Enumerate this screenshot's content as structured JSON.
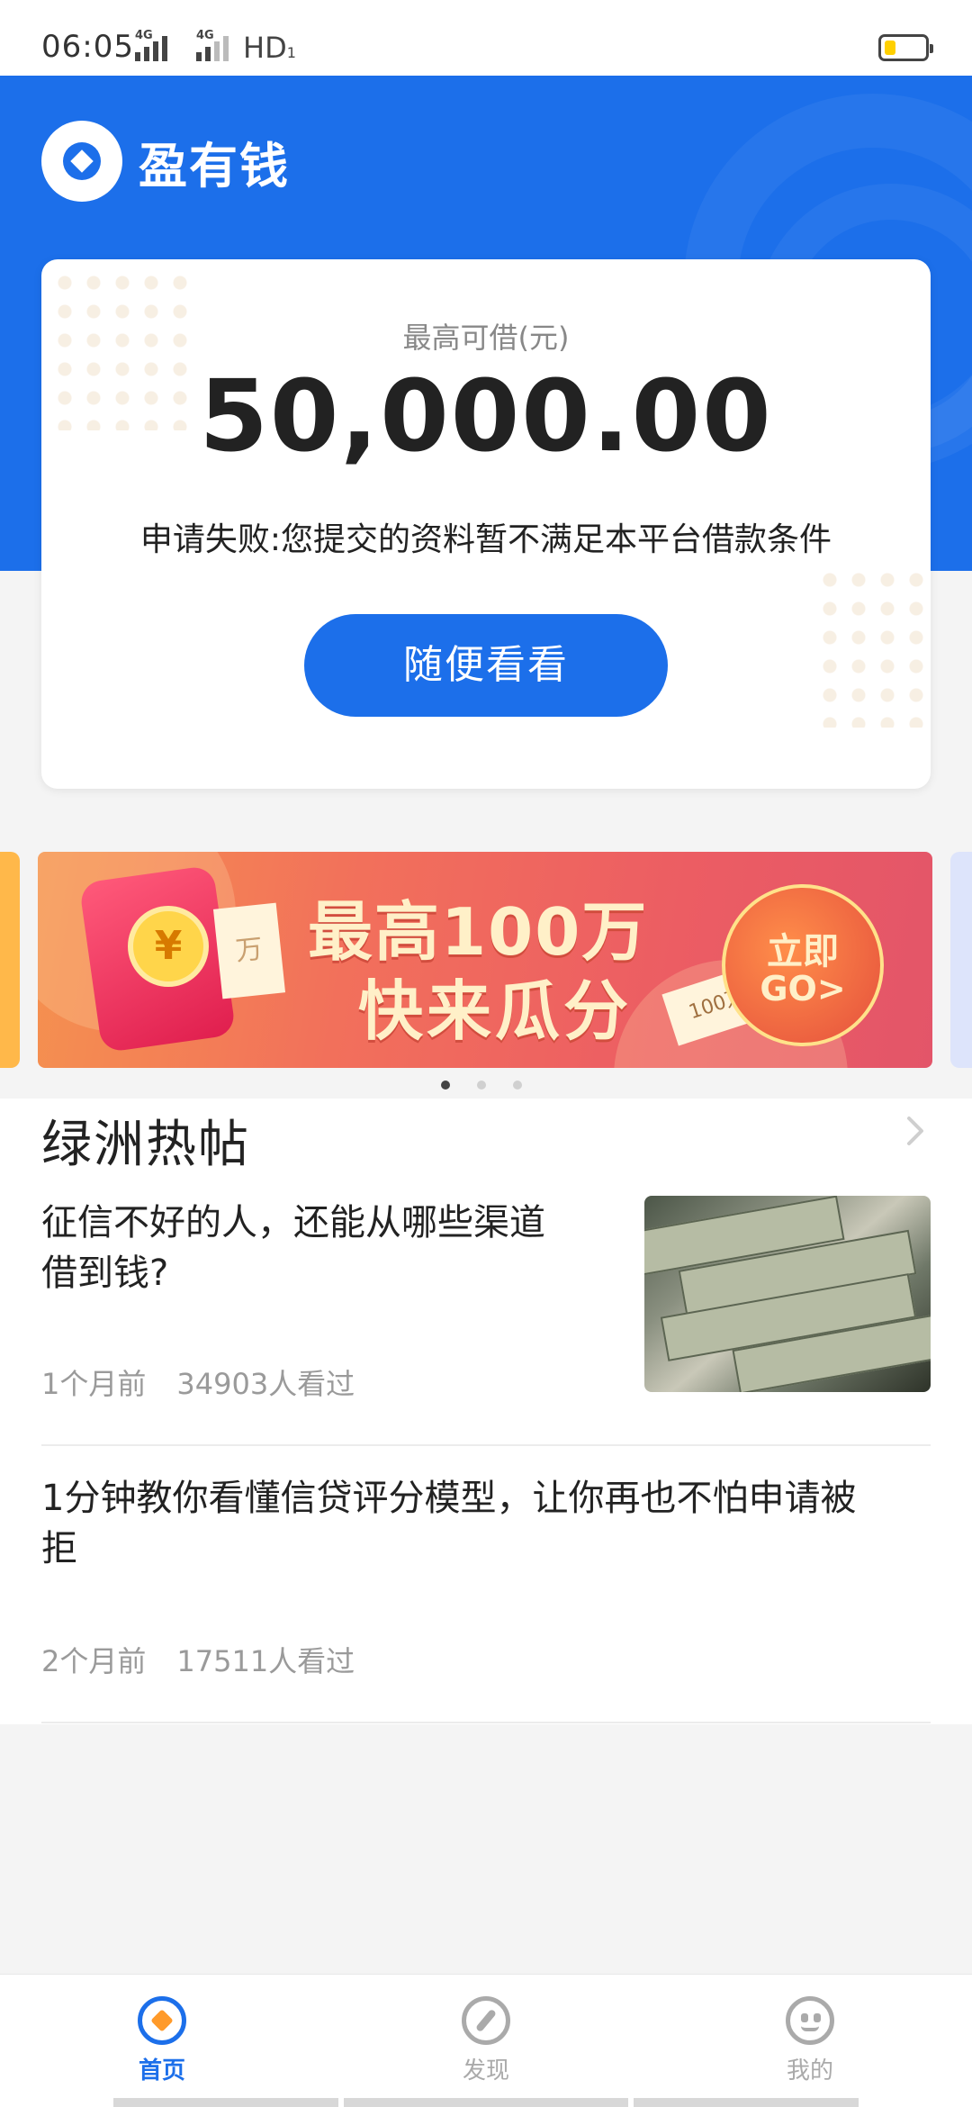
{
  "status_bar": {
    "time": "06:05",
    "network1": "4G",
    "network2": "4G",
    "hd": "HD",
    "hd_sub": "1"
  },
  "header": {
    "app_name": "盈有钱",
    "background_color": "#1c6fea"
  },
  "loan_card": {
    "label": "最高可借(元)",
    "amount": "50,000.00",
    "message": "申请失败:您提交的资料暂不满足本平台借款条件",
    "button_label": "随便看看"
  },
  "banner": {
    "line1": "最高100万",
    "line2": "快来瓜分",
    "coin_symbol": "¥",
    "paper_text": "万",
    "ticket_text": "100万",
    "go_line1": "立即",
    "go_line2": "GO>",
    "current_page": 1,
    "page_count": 3
  },
  "hot_posts": {
    "title": "绿洲热帖",
    "items": [
      {
        "title_line1": "征信不好的人，还能从哪些渠道",
        "title_line2": "借到钱?",
        "time": "1个月前",
        "views": "34903人看过",
        "image_icon": "money-stack-image"
      },
      {
        "title_line1": "1分钟教你看懂信贷评分模型，让你再也不怕申请被",
        "title_line2": "拒",
        "time": "2个月前",
        "views": "17511人看过"
      }
    ]
  },
  "tabs": [
    {
      "label": "首页",
      "icon": "home-icon",
      "active": true
    },
    {
      "label": "发现",
      "icon": "compass-icon",
      "active": false
    },
    {
      "label": "我的",
      "icon": "profile-icon",
      "active": false
    }
  ],
  "colors": {
    "accent": "#1c6fea",
    "banner_orange": "#f2705b",
    "home_dot": "#ff9a2a"
  }
}
